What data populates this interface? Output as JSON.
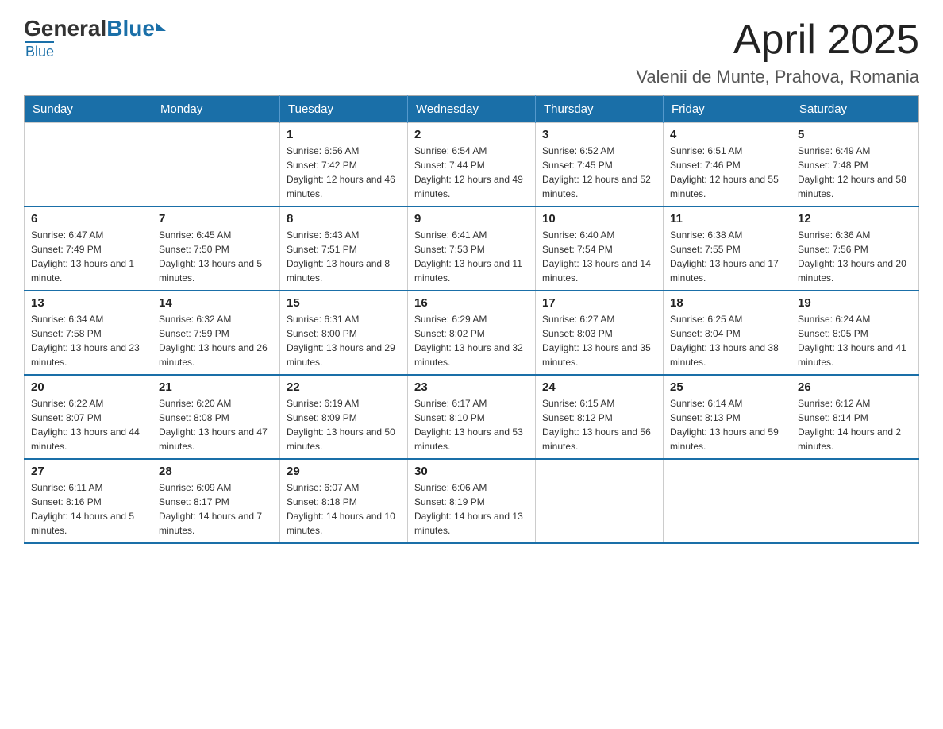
{
  "logo": {
    "general": "General",
    "blue": "Blue",
    "underline": "Blue"
  },
  "header": {
    "month_title": "April 2025",
    "location": "Valenii de Munte, Prahova, Romania"
  },
  "days_of_week": [
    "Sunday",
    "Monday",
    "Tuesday",
    "Wednesday",
    "Thursday",
    "Friday",
    "Saturday"
  ],
  "weeks": [
    [
      {
        "day": "",
        "sunrise": "",
        "sunset": "",
        "daylight": ""
      },
      {
        "day": "",
        "sunrise": "",
        "sunset": "",
        "daylight": ""
      },
      {
        "day": "1",
        "sunrise": "Sunrise: 6:56 AM",
        "sunset": "Sunset: 7:42 PM",
        "daylight": "Daylight: 12 hours and 46 minutes."
      },
      {
        "day": "2",
        "sunrise": "Sunrise: 6:54 AM",
        "sunset": "Sunset: 7:44 PM",
        "daylight": "Daylight: 12 hours and 49 minutes."
      },
      {
        "day": "3",
        "sunrise": "Sunrise: 6:52 AM",
        "sunset": "Sunset: 7:45 PM",
        "daylight": "Daylight: 12 hours and 52 minutes."
      },
      {
        "day": "4",
        "sunrise": "Sunrise: 6:51 AM",
        "sunset": "Sunset: 7:46 PM",
        "daylight": "Daylight: 12 hours and 55 minutes."
      },
      {
        "day": "5",
        "sunrise": "Sunrise: 6:49 AM",
        "sunset": "Sunset: 7:48 PM",
        "daylight": "Daylight: 12 hours and 58 minutes."
      }
    ],
    [
      {
        "day": "6",
        "sunrise": "Sunrise: 6:47 AM",
        "sunset": "Sunset: 7:49 PM",
        "daylight": "Daylight: 13 hours and 1 minute."
      },
      {
        "day": "7",
        "sunrise": "Sunrise: 6:45 AM",
        "sunset": "Sunset: 7:50 PM",
        "daylight": "Daylight: 13 hours and 5 minutes."
      },
      {
        "day": "8",
        "sunrise": "Sunrise: 6:43 AM",
        "sunset": "Sunset: 7:51 PM",
        "daylight": "Daylight: 13 hours and 8 minutes."
      },
      {
        "day": "9",
        "sunrise": "Sunrise: 6:41 AM",
        "sunset": "Sunset: 7:53 PM",
        "daylight": "Daylight: 13 hours and 11 minutes."
      },
      {
        "day": "10",
        "sunrise": "Sunrise: 6:40 AM",
        "sunset": "Sunset: 7:54 PM",
        "daylight": "Daylight: 13 hours and 14 minutes."
      },
      {
        "day": "11",
        "sunrise": "Sunrise: 6:38 AM",
        "sunset": "Sunset: 7:55 PM",
        "daylight": "Daylight: 13 hours and 17 minutes."
      },
      {
        "day": "12",
        "sunrise": "Sunrise: 6:36 AM",
        "sunset": "Sunset: 7:56 PM",
        "daylight": "Daylight: 13 hours and 20 minutes."
      }
    ],
    [
      {
        "day": "13",
        "sunrise": "Sunrise: 6:34 AM",
        "sunset": "Sunset: 7:58 PM",
        "daylight": "Daylight: 13 hours and 23 minutes."
      },
      {
        "day": "14",
        "sunrise": "Sunrise: 6:32 AM",
        "sunset": "Sunset: 7:59 PM",
        "daylight": "Daylight: 13 hours and 26 minutes."
      },
      {
        "day": "15",
        "sunrise": "Sunrise: 6:31 AM",
        "sunset": "Sunset: 8:00 PM",
        "daylight": "Daylight: 13 hours and 29 minutes."
      },
      {
        "day": "16",
        "sunrise": "Sunrise: 6:29 AM",
        "sunset": "Sunset: 8:02 PM",
        "daylight": "Daylight: 13 hours and 32 minutes."
      },
      {
        "day": "17",
        "sunrise": "Sunrise: 6:27 AM",
        "sunset": "Sunset: 8:03 PM",
        "daylight": "Daylight: 13 hours and 35 minutes."
      },
      {
        "day": "18",
        "sunrise": "Sunrise: 6:25 AM",
        "sunset": "Sunset: 8:04 PM",
        "daylight": "Daylight: 13 hours and 38 minutes."
      },
      {
        "day": "19",
        "sunrise": "Sunrise: 6:24 AM",
        "sunset": "Sunset: 8:05 PM",
        "daylight": "Daylight: 13 hours and 41 minutes."
      }
    ],
    [
      {
        "day": "20",
        "sunrise": "Sunrise: 6:22 AM",
        "sunset": "Sunset: 8:07 PM",
        "daylight": "Daylight: 13 hours and 44 minutes."
      },
      {
        "day": "21",
        "sunrise": "Sunrise: 6:20 AM",
        "sunset": "Sunset: 8:08 PM",
        "daylight": "Daylight: 13 hours and 47 minutes."
      },
      {
        "day": "22",
        "sunrise": "Sunrise: 6:19 AM",
        "sunset": "Sunset: 8:09 PM",
        "daylight": "Daylight: 13 hours and 50 minutes."
      },
      {
        "day": "23",
        "sunrise": "Sunrise: 6:17 AM",
        "sunset": "Sunset: 8:10 PM",
        "daylight": "Daylight: 13 hours and 53 minutes."
      },
      {
        "day": "24",
        "sunrise": "Sunrise: 6:15 AM",
        "sunset": "Sunset: 8:12 PM",
        "daylight": "Daylight: 13 hours and 56 minutes."
      },
      {
        "day": "25",
        "sunrise": "Sunrise: 6:14 AM",
        "sunset": "Sunset: 8:13 PM",
        "daylight": "Daylight: 13 hours and 59 minutes."
      },
      {
        "day": "26",
        "sunrise": "Sunrise: 6:12 AM",
        "sunset": "Sunset: 8:14 PM",
        "daylight": "Daylight: 14 hours and 2 minutes."
      }
    ],
    [
      {
        "day": "27",
        "sunrise": "Sunrise: 6:11 AM",
        "sunset": "Sunset: 8:16 PM",
        "daylight": "Daylight: 14 hours and 5 minutes."
      },
      {
        "day": "28",
        "sunrise": "Sunrise: 6:09 AM",
        "sunset": "Sunset: 8:17 PM",
        "daylight": "Daylight: 14 hours and 7 minutes."
      },
      {
        "day": "29",
        "sunrise": "Sunrise: 6:07 AM",
        "sunset": "Sunset: 8:18 PM",
        "daylight": "Daylight: 14 hours and 10 minutes."
      },
      {
        "day": "30",
        "sunrise": "Sunrise: 6:06 AM",
        "sunset": "Sunset: 8:19 PM",
        "daylight": "Daylight: 14 hours and 13 minutes."
      },
      {
        "day": "",
        "sunrise": "",
        "sunset": "",
        "daylight": ""
      },
      {
        "day": "",
        "sunrise": "",
        "sunset": "",
        "daylight": ""
      },
      {
        "day": "",
        "sunrise": "",
        "sunset": "",
        "daylight": ""
      }
    ]
  ]
}
